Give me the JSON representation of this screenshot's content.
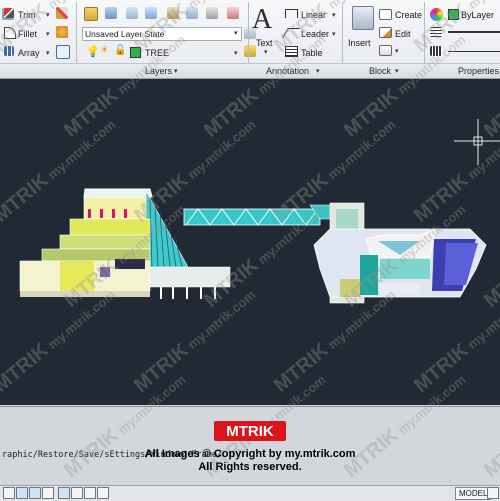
{
  "ribbon": {
    "modify": {
      "trim": "Trim",
      "fillet": "Fillet",
      "array": "Array"
    },
    "layers": {
      "state": "Unsaved Layer State",
      "current_layer": "TREE",
      "panel_label": "Layers"
    },
    "annotation": {
      "text": "Text",
      "linear": "Linear",
      "leader": "Leader",
      "table": "Table",
      "panel_label": "Annotation"
    },
    "block": {
      "insert": "Insert",
      "create": "Create",
      "edit": "Edit",
      "panel_label": "Block"
    },
    "properties": {
      "color": "ByLayer",
      "panel_label": "Properties"
    }
  },
  "watermark": {
    "brand": "MTRIK",
    "site": "my.mtrik.com"
  },
  "command": {
    "line": "raphic/Restore/Save/sEttings/Window/  Frame/"
  },
  "copyright": {
    "logo": "MTRIK",
    "line1": "All Images © Copyright by my.mtrik.com",
    "line2": "All Rights reserved."
  },
  "status": {
    "model_tab": "MODEL"
  },
  "colors": {
    "canvas": "#212a34",
    "accent_red": "#d9141b",
    "cyan": "#38c6c6",
    "yellow": "#e3e75a"
  }
}
